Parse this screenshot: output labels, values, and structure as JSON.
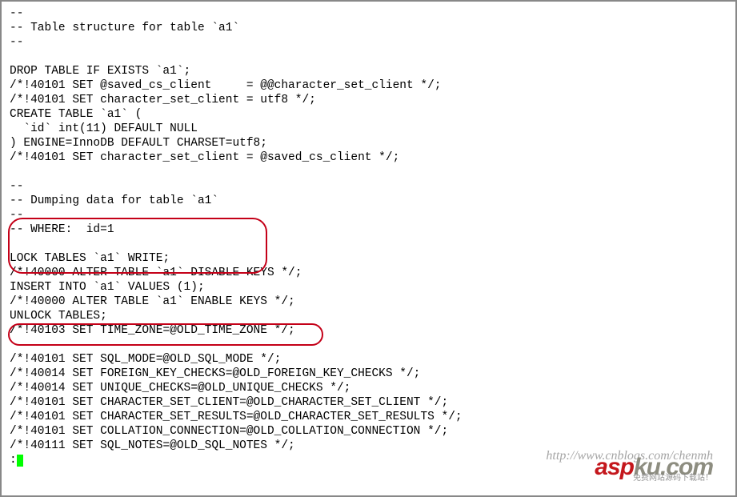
{
  "lines": [
    "--",
    "-- Table structure for table `a1`",
    "--",
    "",
    "DROP TABLE IF EXISTS `a1`;",
    "/*!40101 SET @saved_cs_client     = @@character_set_client */;",
    "/*!40101 SET character_set_client = utf8 */;",
    "CREATE TABLE `a1` (",
    "  `id` int(11) DEFAULT NULL",
    ") ENGINE=InnoDB DEFAULT CHARSET=utf8;",
    "/*!40101 SET character_set_client = @saved_cs_client */;",
    "",
    "--",
    "-- Dumping data for table `a1`",
    "--",
    "-- WHERE:  id=1",
    "",
    "LOCK TABLES `a1` WRITE;",
    "/*!40000 ALTER TABLE `a1` DISABLE KEYS */;",
    "INSERT INTO `a1` VALUES (1);",
    "/*!40000 ALTER TABLE `a1` ENABLE KEYS */;",
    "UNLOCK TABLES;",
    "/*!40103 SET TIME_ZONE=@OLD_TIME_ZONE */;",
    "",
    "/*!40101 SET SQL_MODE=@OLD_SQL_MODE */;",
    "/*!40014 SET FOREIGN_KEY_CHECKS=@OLD_FOREIGN_KEY_CHECKS */;",
    "/*!40014 SET UNIQUE_CHECKS=@OLD_UNIQUE_CHECKS */;",
    "/*!40101 SET CHARACTER_SET_CLIENT=@OLD_CHARACTER_SET_CLIENT */;",
    "/*!40101 SET CHARACTER_SET_RESULTS=@OLD_CHARACTER_SET_RESULTS */;",
    "/*!40101 SET COLLATION_CONNECTION=@OLD_COLLATION_CONNECTION */;",
    "/*!40111 SET SQL_NOTES=@OLD_SQL_NOTES */;"
  ],
  "prompt_prefix": ":",
  "watermark": {
    "url": "http://www.cnblogs.com/chenmh",
    "logo_left": "asp",
    "logo_right": "ku.com",
    "subtitle": "免费网站源码下载站！"
  }
}
